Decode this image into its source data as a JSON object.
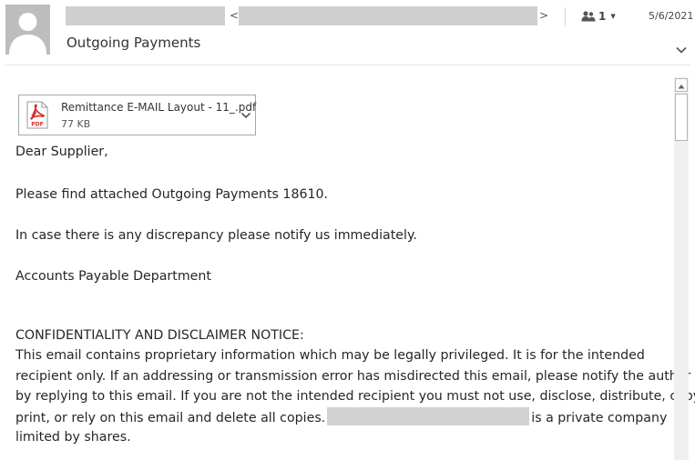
{
  "header": {
    "bracket_open": "<",
    "bracket_close": ">",
    "people_count": "1",
    "date": "5/6/2021",
    "subject": "Outgoing Payments"
  },
  "attachment": {
    "file_name": "Remittance E-MAIL Layout - 11_.pdf",
    "file_size": "77 KB",
    "icon_label": "PDF"
  },
  "body": {
    "greeting": "Dear Supplier,",
    "para1": "Please find attached Outgoing Payments 18610.",
    "para2": "In case there is any discrepancy please notify us immediately.",
    "signature": "Accounts Payable Department",
    "disclaimer_heading": "CONFIDENTIALITY AND DISCLAIMER NOTICE:",
    "disclaimer_line1": "This email contains proprietary information which may be legally privileged. It is for the intended",
    "disclaimer_line2": "recipient only. If an addressing or transmission error has misdirected this email, please notify the author",
    "disclaimer_line3": "by replying to this email. If you are not the intended recipient you must not use, disclose, distribute, copy,",
    "disclaimer_line4_start": "print, or rely on this email and delete all copies.",
    "disclaimer_line4_end": "is a private company",
    "disclaimer_line5": "limited by shares."
  },
  "icons": {
    "avatar": "person-silhouette-icon",
    "people": "people-icon",
    "expand": "chevron-down-icon",
    "attachment_type": "pdf-icon",
    "attachment_menu": "chevron-down-icon",
    "scroll_up": "triangle-up-icon"
  },
  "colors": {
    "pdf_red": "#d32f2f",
    "redaction_gray": "#cfcfcf",
    "avatar_gray": "#bdbdbd"
  }
}
